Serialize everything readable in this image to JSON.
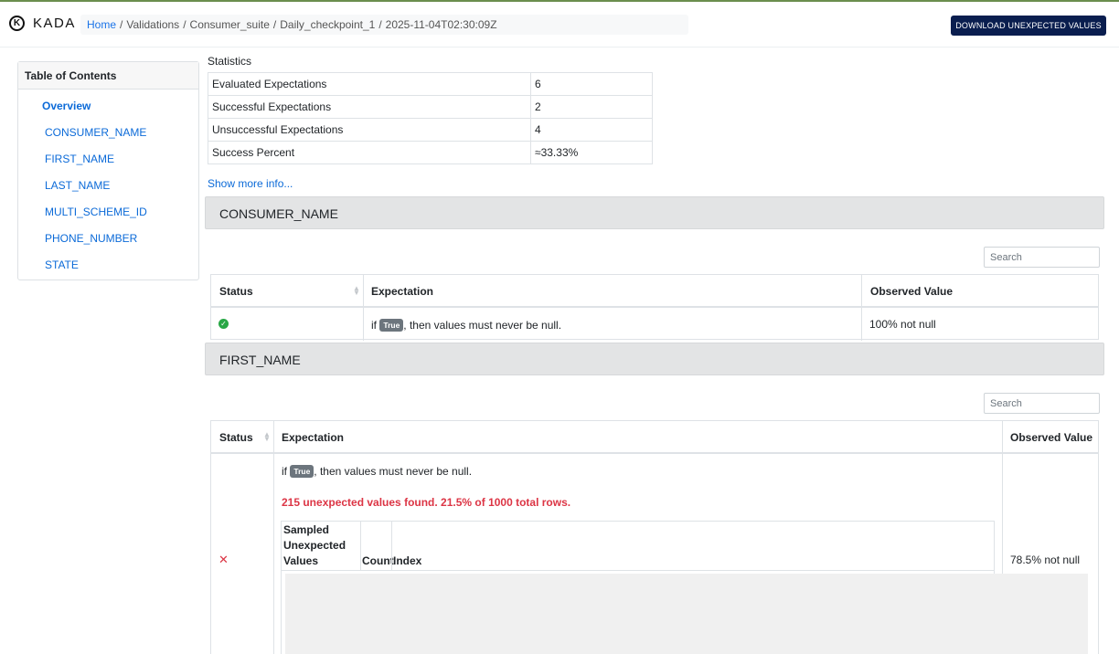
{
  "brand": {
    "logo_letter": "K",
    "name": "KADA"
  },
  "breadcrumb": {
    "home": "Home",
    "items": [
      "Validations",
      "Consumer_suite",
      "Daily_checkpoint_1",
      "2025-11-04T02:30:09Z"
    ]
  },
  "toolbar": {
    "download_label": "DOWNLOAD UNEXPECTED VALUES"
  },
  "toc": {
    "title": "Table of Contents",
    "items": [
      "Overview",
      "CONSUMER_NAME",
      "FIRST_NAME",
      "LAST_NAME",
      "MULTI_SCHEME_ID",
      "PHONE_NUMBER",
      "STATE"
    ]
  },
  "statistics": {
    "title": "Statistics",
    "rows": [
      {
        "label": "Evaluated Expectations",
        "value": "6"
      },
      {
        "label": "Successful Expectations",
        "value": "2"
      },
      {
        "label": "Unsuccessful Expectations",
        "value": "4"
      },
      {
        "label": "Success Percent",
        "value": "≈33.33%"
      }
    ],
    "more_link": "Show more info..."
  },
  "sections": [
    {
      "title": "CONSUMER_NAME",
      "search_placeholder": "Search",
      "headers": {
        "status": "Status",
        "expectation": "Expectation",
        "observed": "Observed Value"
      },
      "row": {
        "status": "success",
        "prefix": "if",
        "badge": "True",
        "suffix": ", then values must never be null.",
        "observed": "100% not null"
      }
    },
    {
      "title": "FIRST_NAME",
      "search_placeholder": "Search",
      "headers": {
        "status": "Status",
        "expectation": "Expectation",
        "observed": "Observed Value"
      },
      "row": {
        "status": "failed",
        "prefix": "if",
        "badge": "True",
        "suffix": ", then values must never be null.",
        "error": "215 unexpected values found. 21.5% of 1000 total rows.",
        "sample_headers": {
          "values": "Sampled\nUnexpected\nValues",
          "count": "Count",
          "index": "Index"
        },
        "observed": "78.5% not null"
      }
    }
  ],
  "colors": {
    "accent": "#0b6ad8",
    "button": "#0a1e4f",
    "success": "#28a745",
    "error": "#dc3545"
  }
}
